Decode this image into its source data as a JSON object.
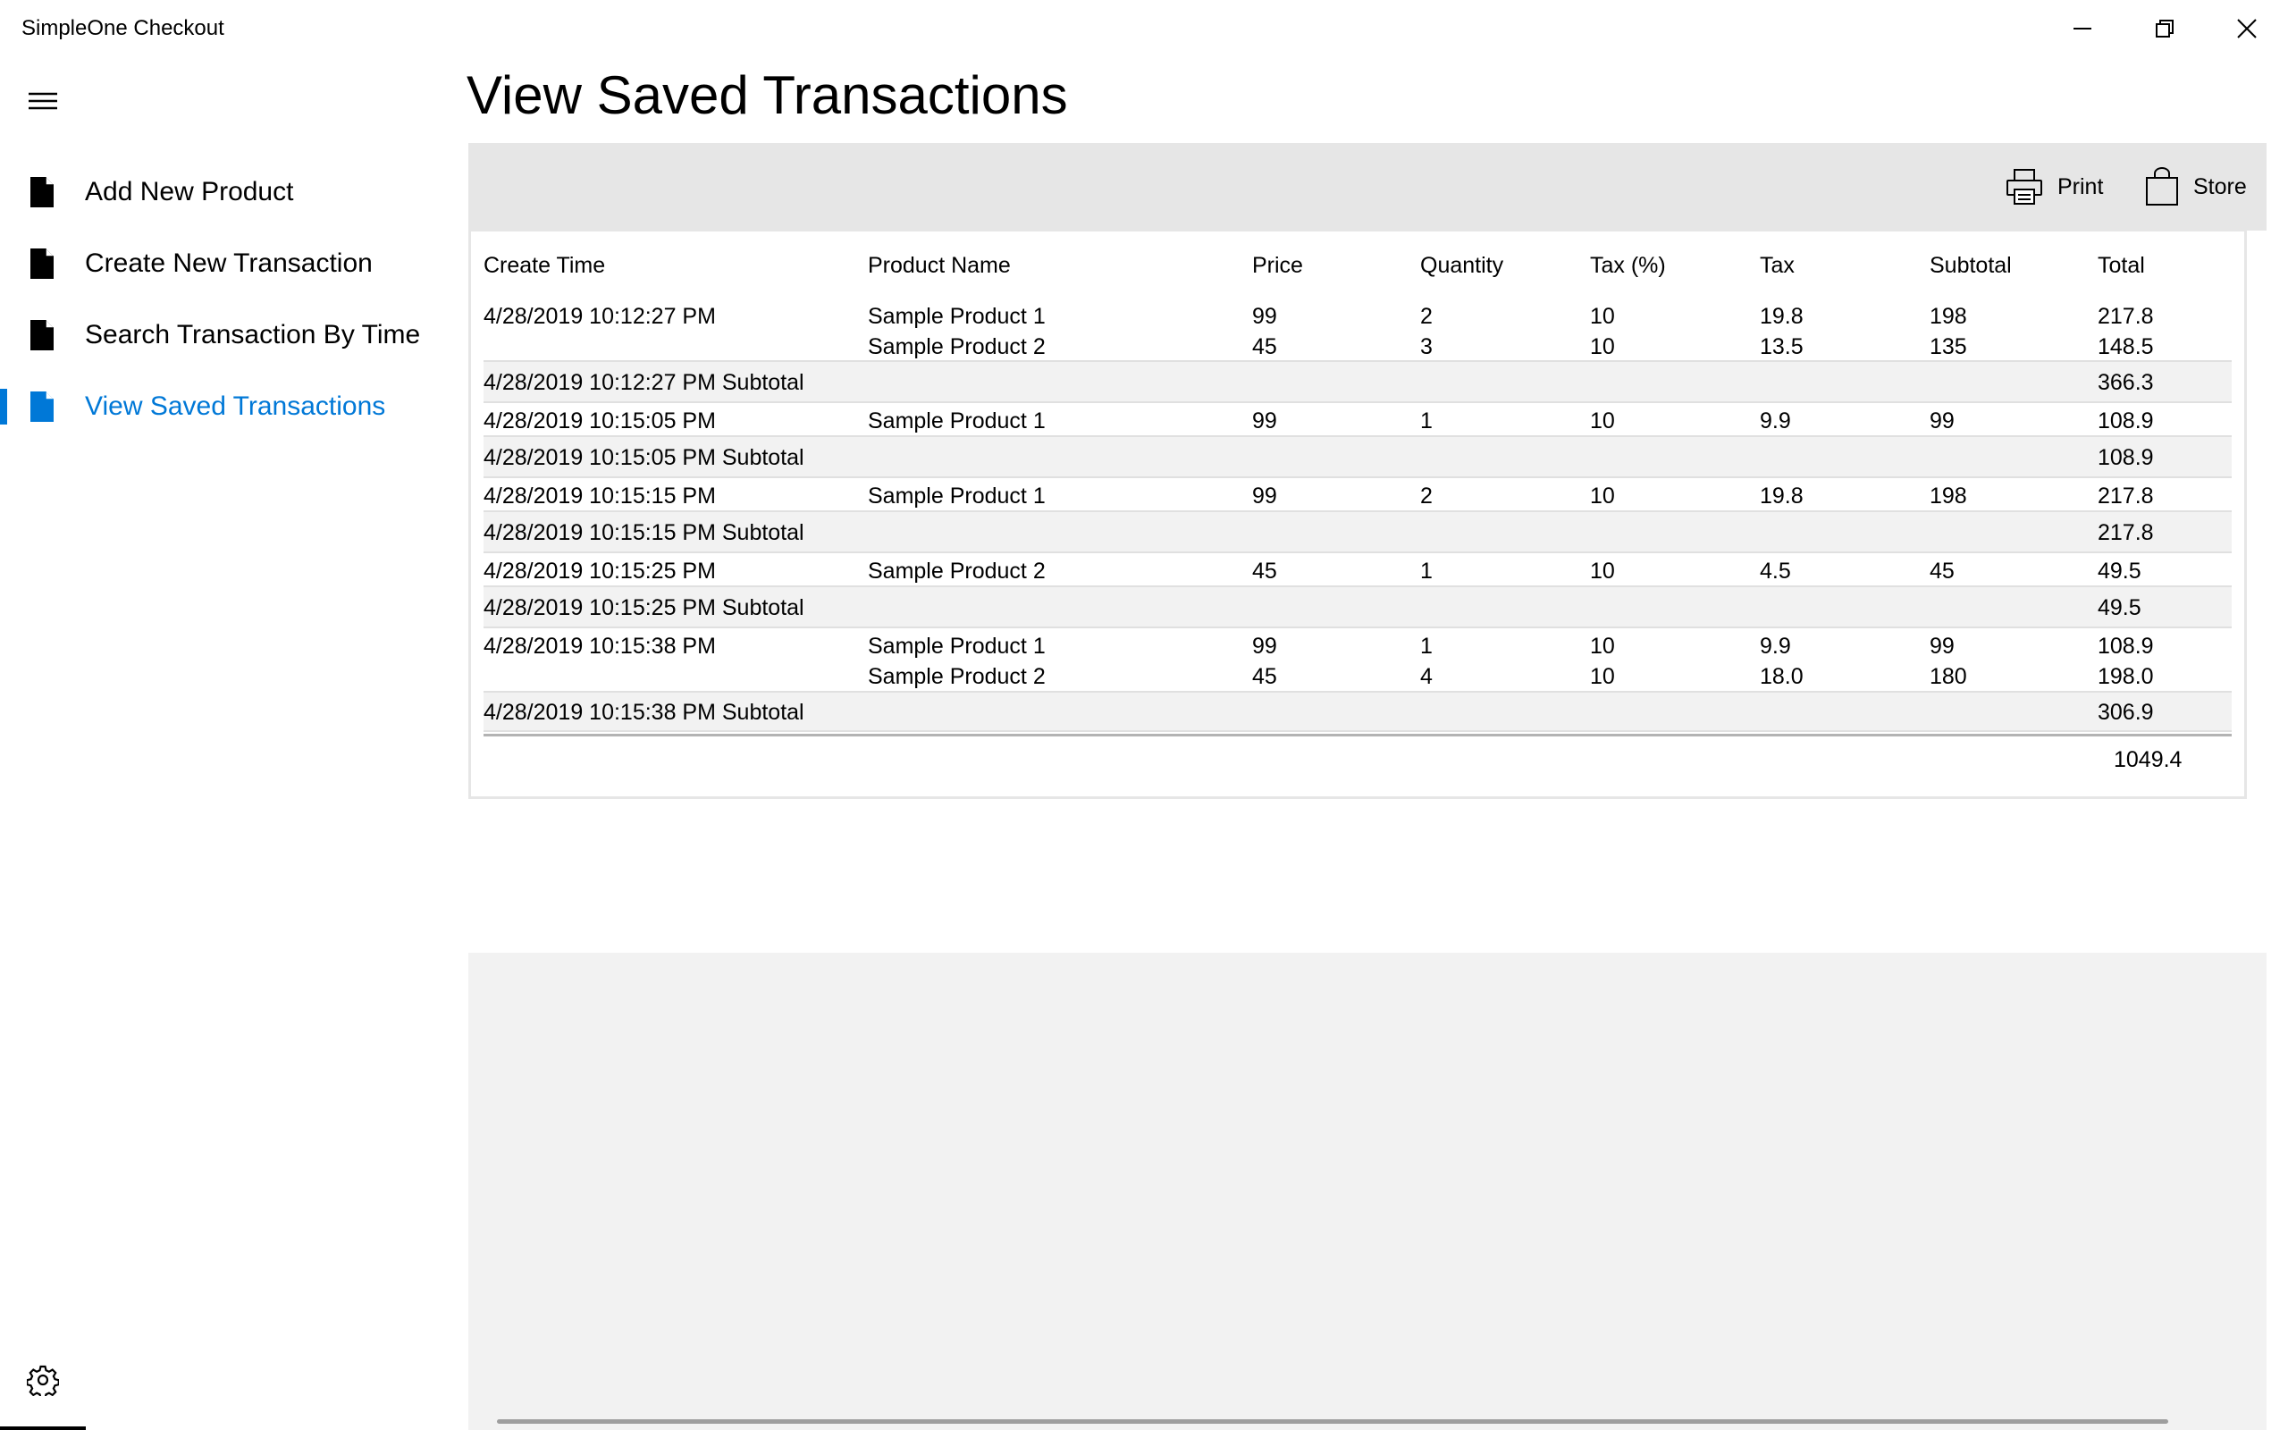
{
  "window": {
    "title": "SimpleOne Checkout"
  },
  "nav": {
    "items": [
      {
        "label": "Add New Product",
        "icon": "document-icon"
      },
      {
        "label": "Create New Transaction",
        "icon": "document-icon"
      },
      {
        "label": "Search Transaction By Time",
        "icon": "document-icon"
      },
      {
        "label": "View Saved Transactions",
        "icon": "document-icon",
        "selected": true
      }
    ]
  },
  "page": {
    "title": "View Saved Transactions"
  },
  "commandbar": {
    "print_label": "Print",
    "store_label": "Store"
  },
  "table": {
    "headers": [
      "Create Time",
      "Product Name",
      "Price",
      "Quantity",
      "Tax (%)",
      "Tax",
      "Subtotal",
      "Total"
    ],
    "transactions": [
      {
        "time": "4/28/2019 10:12:27 PM",
        "lines": [
          {
            "product": "Sample Product 1",
            "price": "99",
            "quantity": "2",
            "tax_pct": "10",
            "tax": "19.8",
            "subtotal": "198",
            "total": "217.8"
          },
          {
            "product": "Sample Product 2",
            "price": "45",
            "quantity": "3",
            "tax_pct": "10",
            "tax": "13.5",
            "subtotal": "135",
            "total": "148.5"
          }
        ],
        "subtotal_label": "4/28/2019 10:12:27 PM Subtotal",
        "subtotal_total": "366.3"
      },
      {
        "time": "4/28/2019 10:15:05 PM",
        "lines": [
          {
            "product": "Sample Product 1",
            "price": "99",
            "quantity": "1",
            "tax_pct": "10",
            "tax": "9.9",
            "subtotal": "99",
            "total": "108.9"
          }
        ],
        "subtotal_label": "4/28/2019 10:15:05 PM Subtotal",
        "subtotal_total": "108.9"
      },
      {
        "time": "4/28/2019 10:15:15 PM",
        "lines": [
          {
            "product": "Sample Product 1",
            "price": "99",
            "quantity": "2",
            "tax_pct": "10",
            "tax": "19.8",
            "subtotal": "198",
            "total": "217.8"
          }
        ],
        "subtotal_label": "4/28/2019 10:15:15 PM Subtotal",
        "subtotal_total": "217.8"
      },
      {
        "time": "4/28/2019 10:15:25 PM",
        "lines": [
          {
            "product": "Sample Product 2",
            "price": "45",
            "quantity": "1",
            "tax_pct": "10",
            "tax": "4.5",
            "subtotal": "45",
            "total": "49.5"
          }
        ],
        "subtotal_label": "4/28/2019 10:15:25 PM Subtotal",
        "subtotal_total": "49.5"
      },
      {
        "time": "4/28/2019 10:15:38 PM",
        "lines": [
          {
            "product": "Sample Product 1",
            "price": "99",
            "quantity": "1",
            "tax_pct": "10",
            "tax": "9.9",
            "subtotal": "99",
            "total": "108.9"
          },
          {
            "product": "Sample Product 2",
            "price": "45",
            "quantity": "4",
            "tax_pct": "10",
            "tax": "18.0",
            "subtotal": "180",
            "total": "198.0"
          }
        ],
        "subtotal_label": "4/28/2019 10:15:38 PM Subtotal",
        "subtotal_total": "306.9"
      }
    ],
    "grand_total": "1049.4"
  },
  "colors": {
    "accent": "#0078d7",
    "commandbar_bg": "#e6e6e6",
    "subtotal_bg": "#f2f2f2"
  }
}
